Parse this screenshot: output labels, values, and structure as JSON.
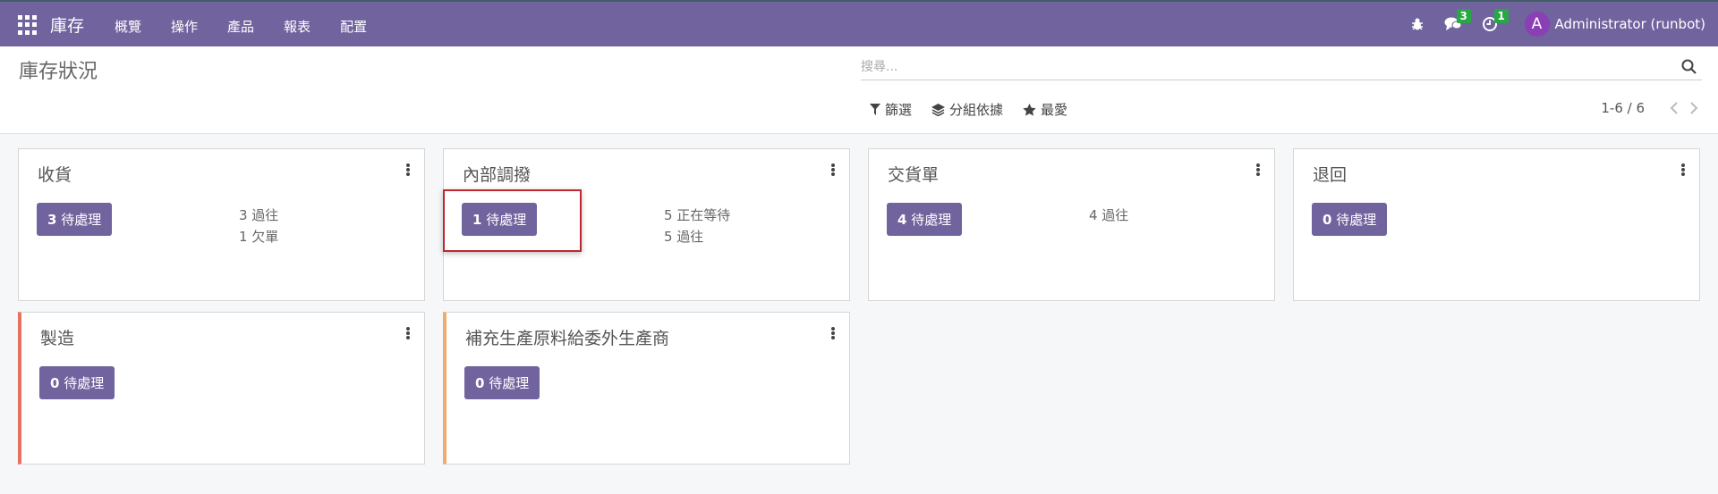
{
  "navbar": {
    "brand": "庫存",
    "menu": [
      "概覽",
      "操作",
      "產品",
      "報表",
      "配置"
    ],
    "messages_count": "3",
    "activities_count": "1",
    "user_initial": "A",
    "user_name": "Administrator (runbot)",
    "icons": [
      "apps-grid-icon",
      "bug-icon",
      "chat-icon",
      "clock-icon"
    ]
  },
  "control_panel": {
    "title": "庫存狀況",
    "search_placeholder": "搜尋...",
    "filters": "篩選",
    "group_by": "分組依據",
    "favorites": "最愛",
    "pager": "1-6 / 6"
  },
  "cards": [
    {
      "title": "收貨",
      "todo_count": "3",
      "todo_label": "待處理",
      "stats": [
        "3 過往",
        "1 欠單"
      ],
      "accent": null
    },
    {
      "title": "內部調撥",
      "todo_count": "1",
      "todo_label": "待處理",
      "stats": [
        "5 正在等待",
        "5 過往"
      ],
      "accent": null
    },
    {
      "title": "交貨單",
      "todo_count": "4",
      "todo_label": "待處理",
      "stats": [
        "4 過往"
      ],
      "accent": null
    },
    {
      "title": "退回",
      "todo_count": "0",
      "todo_label": "待處理",
      "stats": [],
      "accent": null
    },
    {
      "title": "製造",
      "todo_count": "0",
      "todo_label": "待處理",
      "stats": [],
      "accent": "#e5735f"
    },
    {
      "title": "補充生產原料給委外生產商",
      "todo_count": "0",
      "todo_label": "待處理",
      "stats": [],
      "accent": "#f0ab6e"
    }
  ],
  "colors": {
    "primary": "#71639e",
    "badge": "#28a745",
    "highlight": "#c0262d"
  }
}
